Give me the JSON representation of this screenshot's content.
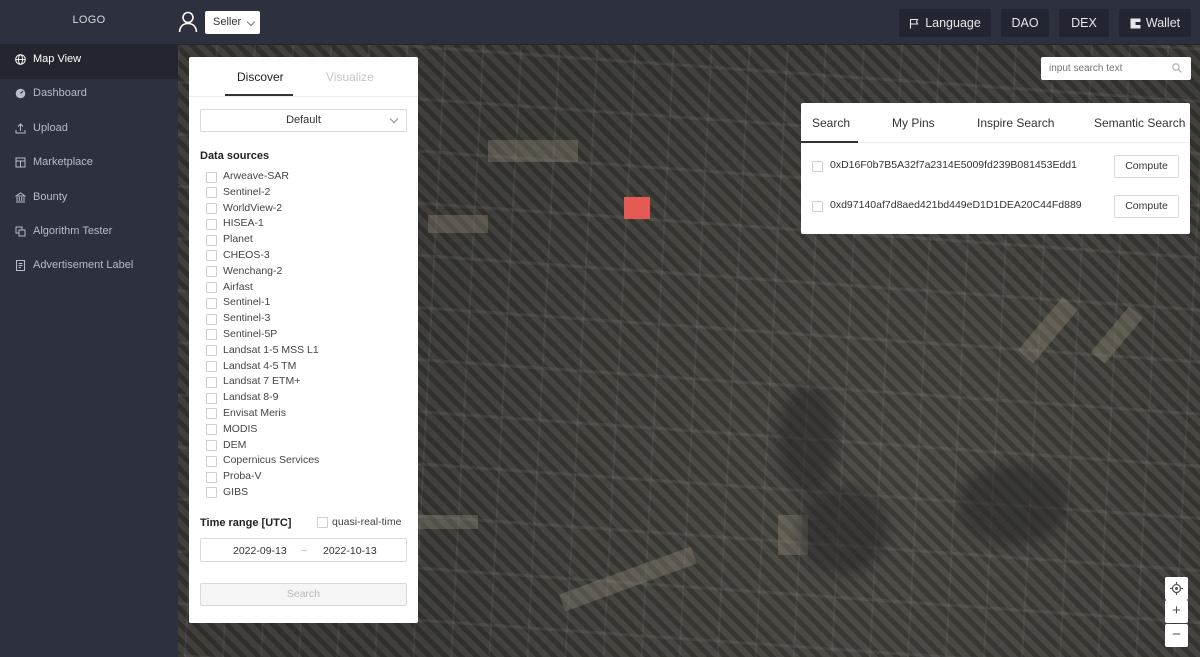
{
  "header": {
    "logo": "LOGO",
    "role_select": "Seller",
    "buttons": {
      "language": "Language",
      "dao": "DAO",
      "dex": "DEX",
      "wallet": "Wallet"
    }
  },
  "sidebar": {
    "items": [
      {
        "label": "Map View",
        "icon": "globe-icon"
      },
      {
        "label": "Dashboard",
        "icon": "dashboard-icon"
      },
      {
        "label": "Upload",
        "icon": "upload-icon"
      },
      {
        "label": "Marketplace",
        "icon": "shop-icon"
      },
      {
        "label": "Bounty",
        "icon": "bank-icon"
      },
      {
        "label": "Algorithm Tester",
        "icon": "copy-icon"
      },
      {
        "label": "Advertisement Label",
        "icon": "label-icon"
      }
    ]
  },
  "discover_panel": {
    "tabs": {
      "discover": "Discover",
      "visualize": "Visualize"
    },
    "preset": "Default",
    "data_sources_label": "Data sources",
    "data_sources": [
      "Arweave-SAR",
      "Sentinel-2",
      "WorldView-2",
      "HISEA-1",
      "Planet",
      "CHEOS-3",
      "Wenchang-2",
      "Airfast",
      "Sentinel-1",
      "Sentinel-3",
      "Sentinel-5P",
      "Landsat 1-5 MSS L1",
      "Landsat 4-5 TM",
      "Landsat 7 ETM+",
      "Landsat 8-9",
      "Envisat Meris",
      "MODIS",
      "DEM",
      "Copernicus Services",
      "Proba-V",
      "GIBS"
    ],
    "time_range_label": "Time range [UTC]",
    "quasi_real_time": "quasi-real-time",
    "date_start": "2022-09-13",
    "date_sep": "~",
    "date_end": "2022-10-13",
    "search_label": "Search"
  },
  "map_search": {
    "placeholder": "input search text"
  },
  "results_panel": {
    "tabs": {
      "search": "Search",
      "my_pins": "My Pins",
      "inspire": "Inspire Search",
      "semantic": "Semantic Search"
    },
    "rows": [
      {
        "hash": "0xD16F0b7B5A32f7a2314E5009fd239B081453Edd1",
        "action": "Compute"
      },
      {
        "hash": "0xd97140af7d8aed421bd449eD1D1DEA20C44Fd889",
        "action": "Compute"
      }
    ]
  },
  "map_controls": {
    "zoom_in": "+",
    "zoom_out": "−"
  }
}
